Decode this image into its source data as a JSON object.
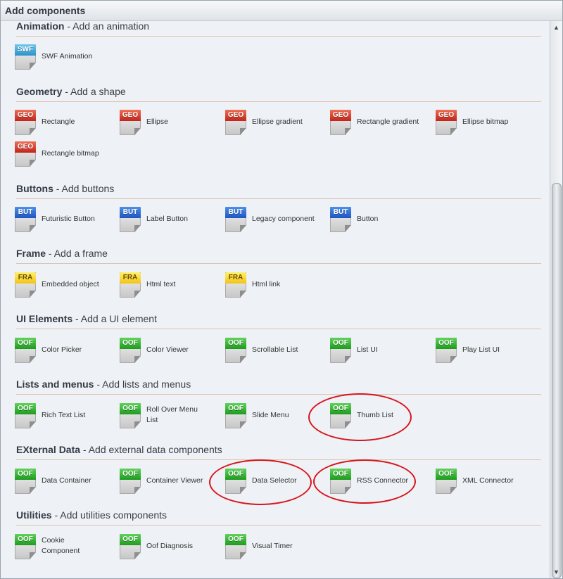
{
  "window": {
    "title": "Add components"
  },
  "icons": {
    "SWF": "SWF",
    "GEO": "GEO",
    "BUT": "BUT",
    "FRA": "FRA",
    "OOF": "OOF"
  },
  "sections": [
    {
      "name": "Animation",
      "desc": " - Add an animation",
      "items": [
        {
          "label": "SWF Animation",
          "icon": "SWF"
        }
      ]
    },
    {
      "name": "Geometry",
      "desc": " - Add a shape",
      "items": [
        {
          "label": "Rectangle",
          "icon": "GEO"
        },
        {
          "label": "Ellipse",
          "icon": "GEO"
        },
        {
          "label": "Ellipse gradient",
          "icon": "GEO"
        },
        {
          "label": "Rectangle gradient",
          "icon": "GEO"
        },
        {
          "label": "Ellipse bitmap",
          "icon": "GEO"
        },
        {
          "label": "Rectangle bitmap",
          "icon": "GEO"
        }
      ]
    },
    {
      "name": "Buttons",
      "desc": " - Add buttons",
      "items": [
        {
          "label": "Futuristic Button",
          "icon": "BUT"
        },
        {
          "label": "Label Button",
          "icon": "BUT"
        },
        {
          "label": "Legacy component",
          "icon": "BUT"
        },
        {
          "label": "Button",
          "icon": "BUT"
        }
      ]
    },
    {
      "name": "Frame",
      "desc": " - Add a frame",
      "items": [
        {
          "label": "Embedded object",
          "icon": "FRA"
        },
        {
          "label": "Html text",
          "icon": "FRA"
        },
        {
          "label": "Html link",
          "icon": "FRA"
        }
      ]
    },
    {
      "name": "UI Elements",
      "desc": " - Add a UI element",
      "items": [
        {
          "label": "Color Picker",
          "icon": "OOF"
        },
        {
          "label": "Color Viewer",
          "icon": "OOF"
        },
        {
          "label": "Scrollable List",
          "icon": "OOF"
        },
        {
          "label": "List UI",
          "icon": "OOF"
        },
        {
          "label": "Play List UI",
          "icon": "OOF"
        }
      ]
    },
    {
      "name": "Lists and menus",
      "desc": " - Add lists and menus",
      "items": [
        {
          "label": "Rich Text List",
          "icon": "OOF"
        },
        {
          "label": "Roll Over Menu List",
          "icon": "OOF"
        },
        {
          "label": "Slide Menu",
          "icon": "OOF"
        },
        {
          "label": "Thumb List",
          "icon": "OOF"
        }
      ]
    },
    {
      "name": "EXternal Data",
      "desc": " - Add external data components",
      "items": [
        {
          "label": "Data Container",
          "icon": "OOF"
        },
        {
          "label": "Container Viewer",
          "icon": "OOF"
        },
        {
          "label": "Data Selector",
          "icon": "OOF"
        },
        {
          "label": "RSS Connector",
          "icon": "OOF"
        },
        {
          "label": "XML Connector",
          "icon": "OOF"
        }
      ]
    },
    {
      "name": "Utilities",
      "desc": " - Add utilities components",
      "items": [
        {
          "label": "Cookie Component",
          "icon": "OOF"
        },
        {
          "label": "Oof Diagnosis",
          "icon": "OOF"
        },
        {
          "label": "Visual Timer",
          "icon": "OOF"
        }
      ]
    }
  ],
  "colors": {
    "highlight": "#d8141b",
    "separator": "#dcc3b0",
    "background": "#eef1f5"
  },
  "highlighted_items": [
    "Thumb List",
    "Data Selector",
    "RSS Connector"
  ]
}
